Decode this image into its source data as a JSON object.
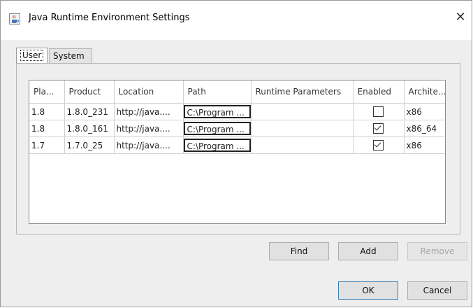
{
  "window": {
    "title": "Java Runtime Environment Settings",
    "close_glyph": "✕"
  },
  "tabs": [
    {
      "label": "User"
    },
    {
      "label": "System"
    }
  ],
  "table": {
    "headers": [
      "Pla...",
      "Product",
      "Location",
      "Path",
      "Runtime Parameters",
      "Enabled",
      "Archite..."
    ],
    "rows": [
      {
        "platform": "1.8",
        "product": "1.8.0_231",
        "location": "http://java....",
        "path": "C:\\Program ...",
        "params": "",
        "enabled": false,
        "arch": "x86"
      },
      {
        "platform": "1.8",
        "product": "1.8.0_161",
        "location": "http://java....",
        "path": "C:\\Program ...",
        "params": "",
        "enabled": true,
        "arch": "x86_64"
      },
      {
        "platform": "1.7",
        "product": "1.7.0_25",
        "location": "http://java....",
        "path": "C:\\Program ...",
        "params": "",
        "enabled": true,
        "arch": "x86"
      }
    ]
  },
  "buttons": {
    "find": "Find",
    "add": "Add",
    "remove": "Remove",
    "ok": "OK",
    "cancel": "Cancel"
  },
  "icons": {
    "app": "java-coffee-cup-icon",
    "close": "close-icon"
  }
}
